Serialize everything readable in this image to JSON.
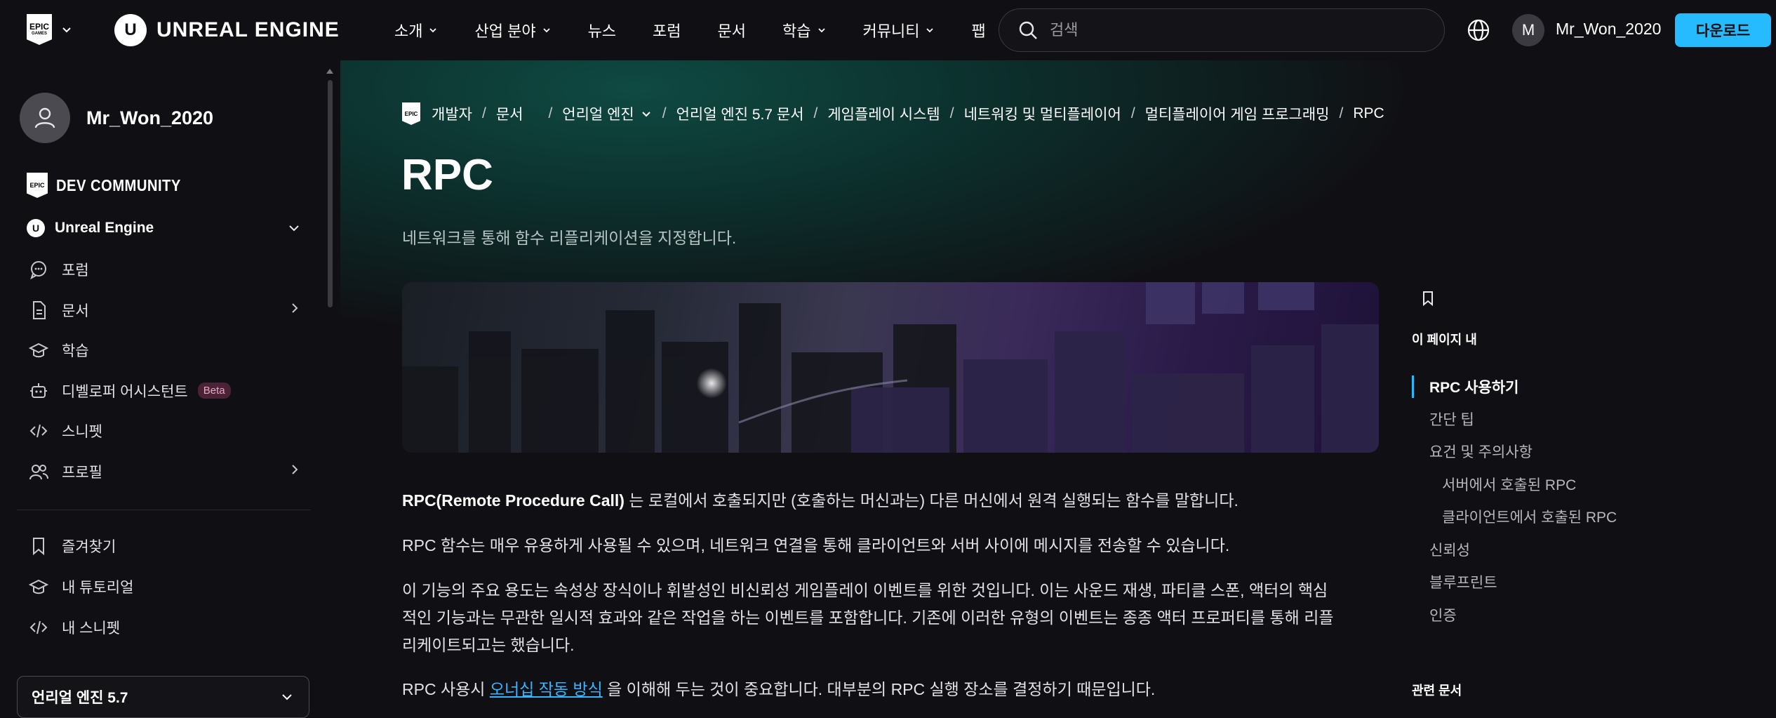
{
  "topnav": {
    "epic_logo_text": "EPIC GAMES",
    "brand": "UNREAL ENGINE",
    "brand_mark": "U",
    "links": [
      {
        "label": "소개",
        "dropdown": true
      },
      {
        "label": "산업 분야",
        "dropdown": true
      },
      {
        "label": "뉴스",
        "dropdown": false
      },
      {
        "label": "포럼",
        "dropdown": false
      },
      {
        "label": "문서",
        "dropdown": false
      },
      {
        "label": "학습",
        "dropdown": true
      },
      {
        "label": "커뮤니티",
        "dropdown": true
      },
      {
        "label": "팹",
        "dropdown": false
      }
    ],
    "search_placeholder": "검색",
    "avatar_initial": "M",
    "username": "Mr_Won_2020",
    "download_label": "다운로드"
  },
  "sidebar": {
    "username": "Mr_Won_2020",
    "dev_community": "DEV COMMUNITY",
    "engine_label": "Unreal Engine",
    "items": [
      {
        "label": "포럼",
        "icon": "chat-bubble-icon",
        "arrow": false
      },
      {
        "label": "문서",
        "icon": "document-icon",
        "arrow": true
      },
      {
        "label": "학습",
        "icon": "graduation-cap-icon",
        "arrow": false
      },
      {
        "label": "디벨로퍼 어시스턴트",
        "icon": "robot-icon",
        "arrow": false,
        "badge": "Beta"
      },
      {
        "label": "스니펫",
        "icon": "code-icon",
        "arrow": false
      },
      {
        "label": "프로필",
        "icon": "users-icon",
        "arrow": true
      }
    ],
    "items2": [
      {
        "label": "즐겨찾기",
        "icon": "bookmark-icon"
      },
      {
        "label": "내 튜토리얼",
        "icon": "graduation-cap-icon"
      },
      {
        "label": "내 스니펫",
        "icon": "code-icon"
      }
    ],
    "version_select": "언리얼 엔진 5.7"
  },
  "breadcrumb": {
    "items": [
      "개발자",
      "문서",
      "언리얼 엔진",
      "언리얼 엔진 5.7 문서",
      "게임플레이 시스템",
      "네트워킹 및 멀티플레이어",
      "멀티플레이어 게임 프로그래밍",
      "RPC"
    ]
  },
  "page": {
    "title": "RPC",
    "subtitle": "네트워크를 통해 함수 리플리케이션을 지정합니다.",
    "p1_bold": "RPC(Remote Procedure Call)",
    "p1_rest": " 는 로컬에서 호출되지만 (호출하는 머신과는) 다른 머신에서 원격 실행되는 함수를 말합니다.",
    "p2": "RPC 함수는 매우 유용하게 사용될 수 있으며, 네트워크 연결을 통해 클라이언트와 서버 사이에 메시지를 전송할 수 있습니다.",
    "p3_line1": "이 기능의 주요 용도는 속성상 장식이나 휘발성인 비신뢰성 게임플레이 이벤트를 위한 것입니다. 이는 사운드 재생, 파티클 스폰, 액터의 핵심",
    "p3_line2": "적인 기능과는 무관한 일시적 효과와 같은 작업을 하는 이벤트를 포함합니다. 기존에 이러한 유형의 이벤트는 종종 액터 프로퍼티를 통해 리플",
    "p3_line3": "리케이트되고는 했습니다.",
    "p4_pre": "RPC 사용시 ",
    "p4_link": "오너십 작동 방식",
    "p4_post": " 을 이해해 두는 것이 중요합니다. 대부분의 RPC 실행 장소를 결정하기 때문입니다."
  },
  "toc": {
    "heading": "이 페이지 내",
    "items": [
      {
        "label": "RPC 사용하기",
        "active": true,
        "indent": false
      },
      {
        "label": "간단 팁",
        "active": false,
        "indent": false
      },
      {
        "label": "요건 및 주의사항",
        "active": false,
        "indent": false
      },
      {
        "label": "서버에서 호출된 RPC",
        "active": false,
        "indent": true
      },
      {
        "label": "클라이언트에서 호출된 RPC",
        "active": false,
        "indent": true
      },
      {
        "label": "신뢰성",
        "active": false,
        "indent": false
      },
      {
        "label": "블루프린트",
        "active": false,
        "indent": false
      },
      {
        "label": "인증",
        "active": false,
        "indent": false
      }
    ],
    "related_heading": "관련 문서"
  },
  "colors": {
    "accent": "#26bbff",
    "background": "#101014",
    "link": "#3ab4ff"
  }
}
